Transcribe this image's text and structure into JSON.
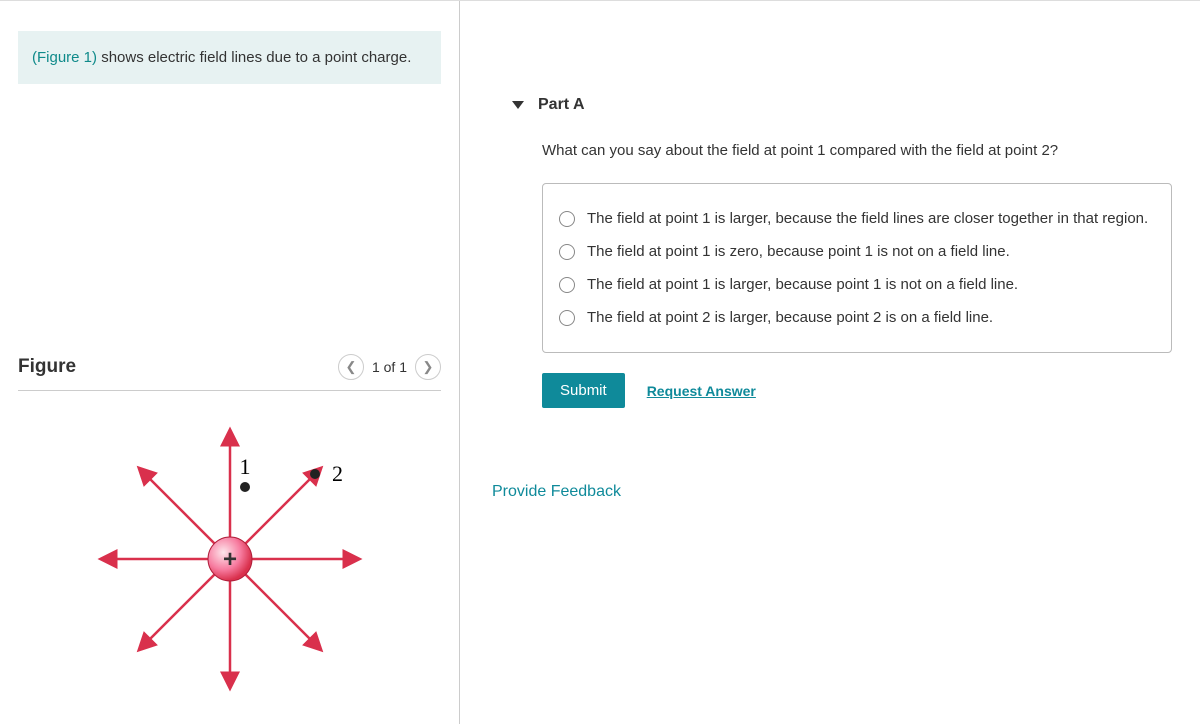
{
  "intro": {
    "figure_ref": "(Figure 1)",
    "text_tail": " shows electric field lines due to a point charge."
  },
  "figure": {
    "title": "Figure",
    "counter": "1 of 1",
    "labels": {
      "point1": "1",
      "point2": "2",
      "center": "+"
    }
  },
  "part": {
    "title": "Part A",
    "question": "What can you say about the field at point 1 compared with the field at point 2?",
    "options": [
      "The field at point 1 is larger, because the field lines are closer together in that region.",
      "The field at point 1 is zero, because point 1 is not on a field line.",
      "The field at point 1 is larger, because point 1 is not on a field line.",
      "The field at point 2 is larger, because point 2 is on a field line."
    ],
    "submit_label": "Submit",
    "request_label": "Request Answer"
  },
  "feedback_label": "Provide Feedback"
}
